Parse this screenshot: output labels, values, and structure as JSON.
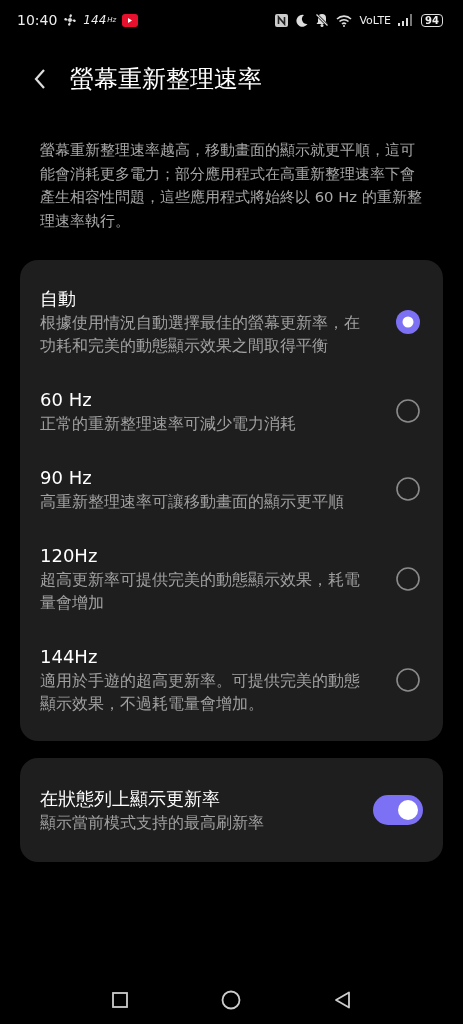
{
  "status_bar": {
    "time": "10:40",
    "refresh_value": "144",
    "refresh_unit": "Hz",
    "network": "VoLTE",
    "battery": "94"
  },
  "header": {
    "title": "螢幕重新整理速率"
  },
  "description": "螢幕重新整理速率越高，移動畫面的顯示就更平順，這可能會消耗更多電力；部分應用程式在高重新整理速率下會產生相容性問題，這些應用程式將始終以 60 Hz 的重新整理速率執行。",
  "options": [
    {
      "title": "自動",
      "subtitle": "根據使用情況自動選擇最佳的螢幕更新率，在功耗和完美的動態顯示效果之間取得平衡",
      "selected": true
    },
    {
      "title": "60 Hz",
      "subtitle": "正常的重新整理速率可減少電力消耗",
      "selected": false
    },
    {
      "title": "90 Hz",
      "subtitle": "高重新整理速率可讓移動畫面的顯示更平順",
      "selected": false
    },
    {
      "title": "120Hz",
      "subtitle": "超高更新率可提供完美的動態顯示效果，耗電量會增加",
      "selected": false
    },
    {
      "title": "144Hz",
      "subtitle": "適用於手遊的超高更新率。可提供完美的動態顯示效果，不過耗電量會增加。",
      "selected": false
    }
  ],
  "status_bar_setting": {
    "title": "在狀態列上顯示更新率",
    "subtitle": "顯示當前模式支持的最高刷新率",
    "on": true
  }
}
